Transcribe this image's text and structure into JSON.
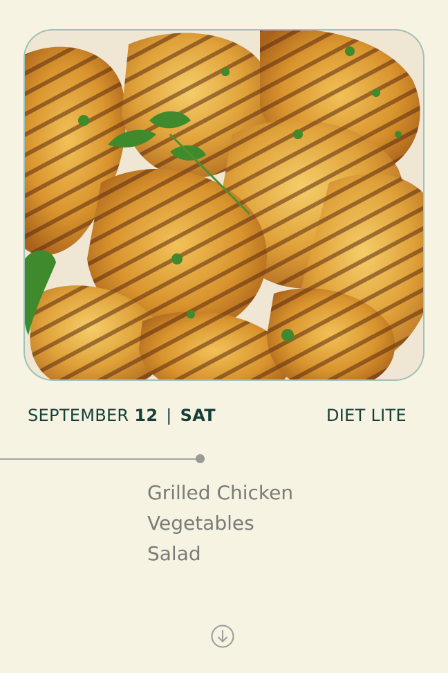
{
  "hero": {
    "image_icon": "grilled-chicken-photo"
  },
  "header": {
    "month": "SEPTEMBER",
    "day": "12",
    "separator": "|",
    "weekday": "SAT",
    "plan": "DIET LITE"
  },
  "menu": {
    "items": [
      "Grilled Chicken",
      "Vegetables",
      "Salad"
    ]
  },
  "scroll": {
    "icon": "arrow-down-circle-icon"
  },
  "colors": {
    "background": "#f6f3e2",
    "primary_text": "#163f39",
    "menu_text": "#7b7b78",
    "divider": "#a4a4a0",
    "image_border": "#9ec2bd"
  }
}
